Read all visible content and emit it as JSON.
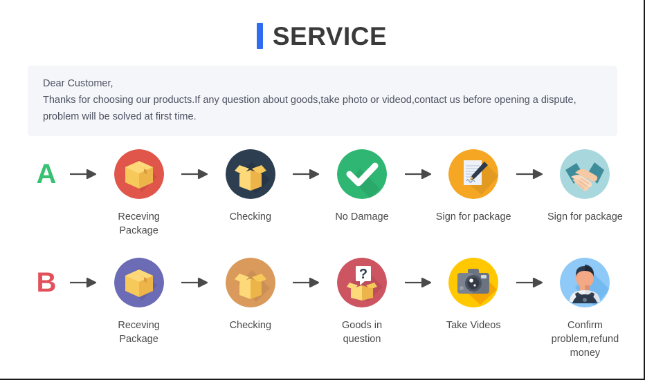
{
  "header": {
    "title": "SERVICE",
    "accent_color": "#2f6cf0"
  },
  "notice": {
    "line1": "Dear Customer,",
    "line2": "Thanks for choosing our products.If any question about goods,take photo or videod,contact us before opening a dispute,",
    "line3": "problem will be solved at first time.",
    "background_color": "#f5f6fa",
    "text_color": "#4c5160"
  },
  "flows": [
    {
      "letter": "A",
      "letter_color": "#38c172",
      "steps": [
        {
          "label": "Receving Package",
          "icon": "closed-box-icon",
          "circle_color": "#e0564a"
        },
        {
          "label": "Checking",
          "icon": "open-box-icon",
          "circle_color": "#2c3e50"
        },
        {
          "label": "No Damage",
          "icon": "check-mark-icon",
          "circle_color": "#2fb673"
        },
        {
          "label": "Sign for package",
          "icon": "document-pen-icon",
          "circle_color": "#f5a623"
        },
        {
          "label": "Sign for package",
          "icon": "handshake-icon",
          "circle_color": "#a8d8dd"
        }
      ]
    },
    {
      "letter": "B",
      "letter_color": "#e2515b",
      "steps": [
        {
          "label": "Receving Package",
          "icon": "closed-box-icon",
          "circle_color": "#6c6bb5"
        },
        {
          "label": "Checking",
          "icon": "open-box-icon",
          "circle_color": "#d99a5b"
        },
        {
          "label": "Goods in question",
          "icon": "question-box-icon",
          "circle_color": "#cc5561"
        },
        {
          "label": "Take Videos",
          "icon": "camera-icon",
          "circle_color": "#ffc800"
        },
        {
          "label": "Confirm problem,refund money",
          "icon": "person-icon",
          "circle_color": "#8ec9f7"
        }
      ]
    }
  ],
  "arrow": {
    "name": "right-arrow-icon",
    "color": "#4a4a4a"
  }
}
